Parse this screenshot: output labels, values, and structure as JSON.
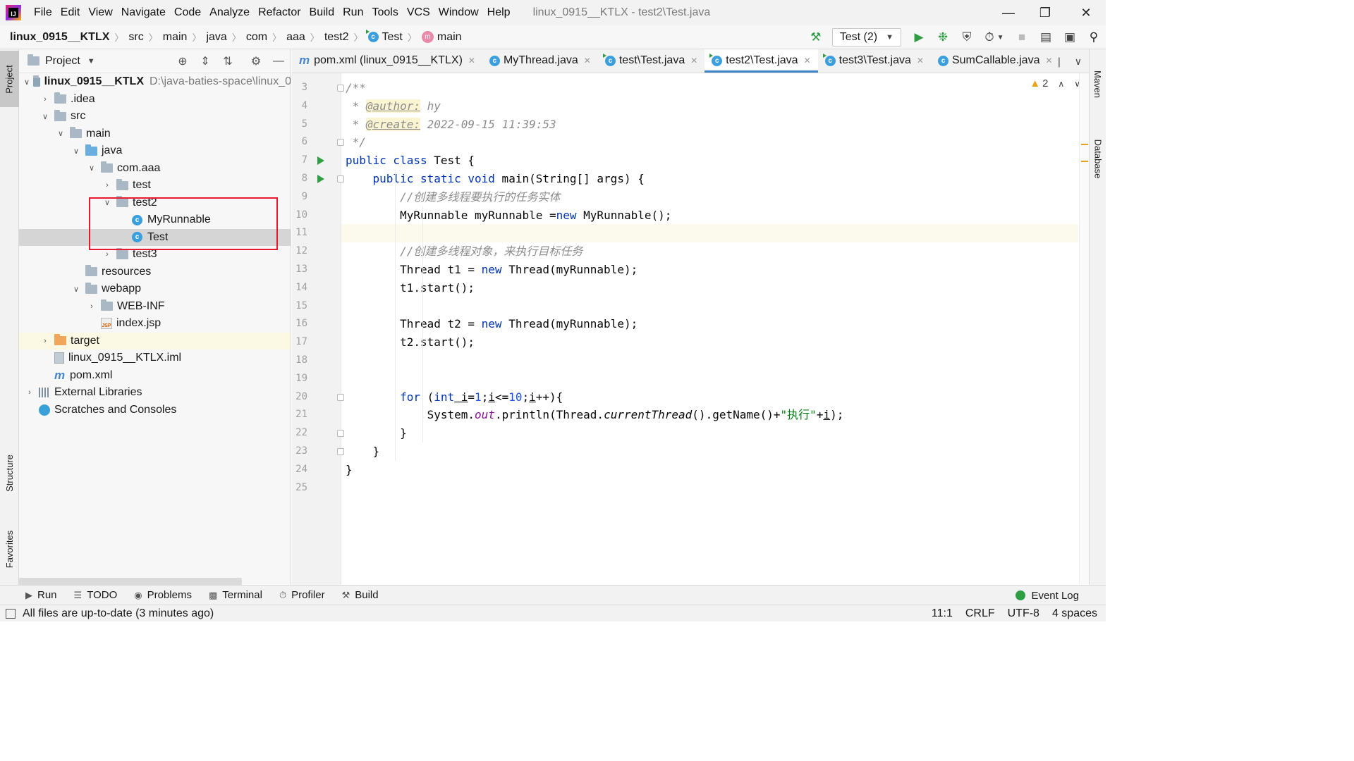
{
  "menu": {
    "items": [
      "File",
      "Edit",
      "View",
      "Navigate",
      "Code",
      "Analyze",
      "Refactor",
      "Build",
      "Run",
      "Tools",
      "VCS",
      "Window",
      "Help"
    ],
    "window_title": "linux_0915__KTLX - test2\\Test.java"
  },
  "breadcrumbs": {
    "project": "linux_0915__KTLX",
    "items": [
      "src",
      "main",
      "java",
      "com",
      "aaa",
      "test2"
    ],
    "class_name": "Test",
    "method_name": "main"
  },
  "toolbar": {
    "run_config": "Test (2)"
  },
  "side_tabs": {
    "project": "Project",
    "structure": "Structure",
    "favorites": "Favorites",
    "maven": "Maven",
    "database": "Database"
  },
  "project_panel": {
    "title": "Project",
    "root": {
      "name": "linux_0915__KTLX",
      "path": "D:\\java-baties-space\\linux_0"
    },
    "tree": [
      {
        "label": ".idea"
      },
      {
        "label": "src"
      },
      {
        "label": "main"
      },
      {
        "label": "java"
      },
      {
        "label": "com.aaa"
      },
      {
        "label": "test"
      },
      {
        "label": "test2"
      },
      {
        "label": "MyRunnable"
      },
      {
        "label": "Test"
      },
      {
        "label": "test3"
      },
      {
        "label": "resources"
      },
      {
        "label": "webapp"
      },
      {
        "label": "WEB-INF"
      },
      {
        "label": "index.jsp"
      },
      {
        "label": "target"
      },
      {
        "label": "linux_0915__KTLX.iml"
      },
      {
        "label": "pom.xml"
      },
      {
        "label": "External Libraries"
      },
      {
        "label": "Scratches and Consoles"
      }
    ]
  },
  "editor": {
    "tabs": [
      {
        "label": "pom.xml (linux_0915__KTLX)"
      },
      {
        "label": "MyThread.java"
      },
      {
        "label": "test\\Test.java"
      },
      {
        "label": "test2\\Test.java",
        "active": true
      },
      {
        "label": "test3\\Test.java"
      },
      {
        "label": "SumCallable.java"
      }
    ],
    "warning_count": "2",
    "line_numbers": [
      "3",
      "4",
      "5",
      "6",
      "7",
      "8",
      "9",
      "10",
      "11",
      "12",
      "13",
      "14",
      "15",
      "16",
      "17",
      "18",
      "19",
      "20",
      "21",
      "22",
      "23",
      "24",
      "25"
    ],
    "current_line": "11",
    "code": {
      "l3": "/**",
      "l4_prefix": " * ",
      "l4_tag": "@author:",
      "l4_value": " hy",
      "l5_prefix": " * ",
      "l5_tag": "@create:",
      "l5_value": " 2022-09-15 11:39:53",
      "l6": " */",
      "l7_kw": "public class",
      "l7_rest": " Test {",
      "l8_kw": "public static void",
      "l8_rest": " main(String[] args) {",
      "l9": "//创建多线程要执行的任务实体",
      "l10_a": "MyRunnable myRunnable =",
      "l10_kw": "new",
      "l10_b": " MyRunnable();",
      "l12": "//创建多线程对象，来执行目标任务",
      "l13_a": "Thread t1 = ",
      "l13_kw": "new",
      "l13_b": " Thread(myRunnable);",
      "l14": "t1.start();",
      "l16_a": "Thread t2 = ",
      "l16_kw": "new",
      "l16_b": " Thread(myRunnable);",
      "l17": "t2.start();",
      "l20_for": "for",
      "l20_a": " (",
      "l20_int": "int",
      "l20_i1": " i",
      "l20_eq": "=",
      "l20_n1": "1",
      "l20_semi1": ";",
      "l20_i2": "i",
      "l20_le": "<=",
      "l20_n2": "10",
      "l20_semi2": ";",
      "l20_i3": "i",
      "l20_end": "++){",
      "l21_a": "System.",
      "l21_out": "out",
      "l21_b": ".println(Thread.",
      "l21_ct": "currentThread",
      "l21_c": "().getName()+",
      "l21_str": "\"执行\"",
      "l21_d": "+",
      "l21_i": "i",
      "l21_e": ");",
      "l22": "}",
      "l23": "}",
      "l24": "}"
    }
  },
  "bottom_tools": {
    "items": [
      "Run",
      "TODO",
      "Problems",
      "Terminal",
      "Profiler",
      "Build"
    ],
    "event_log": "Event Log"
  },
  "status": {
    "message": "All files are up-to-date (3 minutes ago)",
    "position": "11:1",
    "line_sep": "CRLF",
    "encoding": "UTF-8",
    "indent": "4 spaces"
  },
  "colors": {
    "keyword": "#0033b3",
    "comment": "#8c8c8c",
    "string": "#067d17",
    "number": "#1750eb",
    "field": "#871094",
    "highlight_box": "#e8192c",
    "active_tab_underline": "#4083c9"
  }
}
